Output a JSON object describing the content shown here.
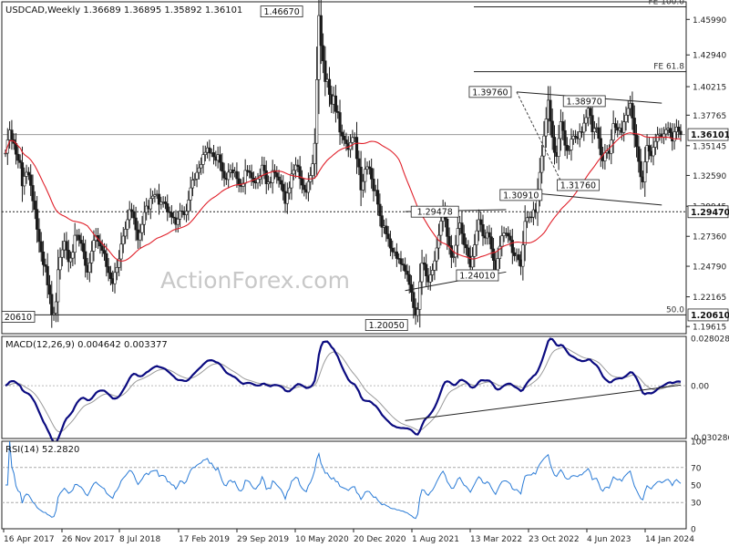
{
  "chart_data": [
    {
      "panel": "price",
      "type": "candlestick",
      "title": "USDCAD,Weekly",
      "ohlc_header": "1.36689 1.36895 1.35892 1.36101",
      "watermark": "ActionForex.com",
      "y_ticks": [
        "1.45990",
        "1.42940",
        "1.40215",
        "1.37765",
        "1.35145",
        "1.32590",
        "1.29945",
        "1.27360",
        "1.24790",
        "1.22165",
        "1.19615"
      ],
      "ylim": [
        1.19,
        1.475
      ],
      "current_price": "1.36101",
      "level_lines": [
        {
          "label": "FE 100.0",
          "value": 1.4707
        },
        {
          "label": "FE 61.8",
          "value": 1.415
        },
        {
          "label": "50.0",
          "value": 1.2061
        }
      ],
      "price_labels": [
        {
          "text": "1.46670",
          "value": 1.4667
        },
        {
          "text": "1.39760",
          "value": 1.3976
        },
        {
          "text": "1.38970",
          "value": 1.3897
        },
        {
          "text": "1.31760",
          "value": 1.3176
        },
        {
          "text": "1.30910",
          "value": 1.3091
        },
        {
          "text": "1.29478",
          "value": 1.29478
        },
        {
          "text": "1.24010",
          "value": 1.2401
        },
        {
          "text": "1.20050",
          "value": 1.2005
        },
        {
          "text": "1.20610",
          "value": 1.2061
        }
      ],
      "axis_badges": [
        {
          "text": "1.36101",
          "value": 1.36101
        },
        {
          "text": "1.29470",
          "value": 1.2947
        },
        {
          "text": "1.20610",
          "value": 1.2061
        }
      ],
      "left_edge_label": "20610",
      "x_labels": [
        "16 Apr 2017",
        "26 Nov 2017",
        "8 Jul 2018",
        "17 Feb 2019",
        "29 Sep 2019",
        "10 May 2020",
        "20 Dec 2020",
        "1 Aug 2021",
        "13 Mar 2022",
        "23 Oct 2022",
        "4 Jun 2023",
        "14 Jan 2024"
      ],
      "closes": [
        1.345,
        1.3564,
        1.3649,
        1.3566,
        1.3534,
        1.3441,
        1.3388,
        1.3369,
        1.3169,
        1.3251,
        1.3286,
        1.3264,
        1.3173,
        1.304,
        1.2967,
        1.2796,
        1.2691,
        1.2602,
        1.2492,
        1.2478,
        1.2318,
        1.2238,
        1.2065,
        1.2076,
        1.2174,
        1.2449,
        1.2556,
        1.262,
        1.2693,
        1.2617,
        1.2518,
        1.2549,
        1.2599,
        1.2745,
        1.2746,
        1.2703,
        1.2675,
        1.2605,
        1.2486,
        1.2427,
        1.2508,
        1.2609,
        1.2701,
        1.2743,
        1.2693,
        1.2653,
        1.2615,
        1.2588,
        1.2476,
        1.2424,
        1.2373,
        1.2329,
        1.2426,
        1.2469,
        1.2542,
        1.2669,
        1.2738,
        1.2797,
        1.2879,
        1.2965,
        1.2949,
        1.2894,
        1.2792,
        1.2705,
        1.2768,
        1.2838,
        1.2942,
        1.2996,
        1.2972,
        1.3061,
        1.3081,
        1.3094,
        1.3098,
        1.3011,
        1.3032,
        1.3032,
        1.3016,
        1.2946,
        1.2941,
        1.2901,
        1.2895,
        1.2838,
        1.2884,
        1.2954,
        1.2949,
        1.2921,
        1.2952,
        1.3048,
        1.3152,
        1.3219,
        1.3228,
        1.3285,
        1.3324,
        1.3353,
        1.3438,
        1.3457,
        1.3496,
        1.3452,
        1.3455,
        1.3419,
        1.3389,
        1.3437,
        1.3371,
        1.3295,
        1.3236,
        1.3224,
        1.3287,
        1.3307,
        1.3281,
        1.3293,
        1.3231,
        1.3175,
        1.3165,
        1.3192,
        1.3302,
        1.3298,
        1.3284,
        1.3237,
        1.3201,
        1.3194,
        1.3228,
        1.3256,
        1.3347,
        1.3299,
        1.3187,
        1.3203,
        1.3196,
        1.3301,
        1.3281,
        1.3246,
        1.3216,
        1.3184,
        1.3122,
        1.3018,
        1.3107,
        1.3152,
        1.3271,
        1.3303,
        1.3348,
        1.3335,
        1.3232,
        1.3176,
        1.3137,
        1.3114,
        1.3206,
        1.3258,
        1.3359,
        1.3535,
        1.4082,
        1.4632,
        1.4374,
        1.4243,
        1.4065,
        1.4084,
        1.3954,
        1.3871,
        1.3942,
        1.3808,
        1.3799,
        1.3631,
        1.3597,
        1.3564,
        1.3532,
        1.3482,
        1.3542,
        1.3585,
        1.3587,
        1.3403,
        1.3331,
        1.3134,
        1.3207,
        1.3312,
        1.3333,
        1.3321,
        1.3228,
        1.3127,
        1.3132,
        1.3012,
        1.2913,
        1.2813,
        1.2825,
        1.2756,
        1.2715,
        1.2635,
        1.2603,
        1.2603,
        1.2546,
        1.2544,
        1.2498,
        1.2489,
        1.2437,
        1.2408,
        1.2322,
        1.2255,
        1.2123,
        1.2057,
        1.2109,
        1.2346,
        1.2508,
        1.2496,
        1.2396,
        1.2344,
        1.2405,
        1.2445,
        1.2525,
        1.2636,
        1.2745,
        1.2867,
        1.2959,
        1.2884,
        1.2735,
        1.2656,
        1.2555,
        1.2559,
        1.2659,
        1.2804,
        1.2851,
        1.2759,
        1.2664,
        1.2637,
        1.2565,
        1.2472,
        1.2563,
        1.2663,
        1.2783,
        1.2879,
        1.2837,
        1.2739,
        1.2722,
        1.2768,
        1.2732,
        1.2628,
        1.2529,
        1.2445,
        1.2545,
        1.2651,
        1.2741,
        1.2764,
        1.2763,
        1.2738,
        1.2703,
        1.2595,
        1.2569,
        1.2578,
        1.2534,
        1.2478,
        1.2662,
        1.2864,
        1.2896,
        1.2902,
        1.2901,
        1.2964,
        1.2942,
        1.3118,
        1.3285,
        1.3426,
        1.3598,
        1.3744,
        1.3905,
        1.3725,
        1.3587,
        1.3456,
        1.3422,
        1.3576,
        1.3721,
        1.3644,
        1.3518,
        1.3472,
        1.3478,
        1.3571,
        1.3597,
        1.3589,
        1.3574,
        1.3634,
        1.3631,
        1.3708,
        1.3756,
        1.3836,
        1.3774,
        1.3633,
        1.3662,
        1.3669,
        1.3577,
        1.3435,
        1.3384,
        1.3454,
        1.3469,
        1.3448,
        1.3563,
        1.3704,
        1.3671,
        1.3647,
        1.3665,
        1.3628,
        1.3719,
        1.3777,
        1.3834,
        1.3878,
        1.3752,
        1.3606,
        1.3506,
        1.3379,
        1.3247,
        1.3203,
        1.3376,
        1.3516,
        1.3467,
        1.3427,
        1.3501,
        1.3551,
        1.3607,
        1.3615,
        1.3588,
        1.3615,
        1.3652,
        1.3664,
        1.3626,
        1.3554,
        1.3634,
        1.3675,
        1.3639,
        1.361
      ],
      "moving_average": {
        "name": "MA",
        "color": "#e0202a"
      },
      "triangle_lines": [
        {
          "from": {
            "x_index": 243,
            "value": 1.3976
          },
          "to": {
            "x_index": 312,
            "value": 1.388
          }
        },
        {
          "from": {
            "x_index": 243,
            "value": 1.312
          },
          "to": {
            "x_index": 312,
            "value": 1.3005
          }
        }
      ]
    },
    {
      "panel": "macd",
      "type": "line",
      "title": "MACD(12,26,9) 0.004642 0.003377",
      "y_ticks": [
        "0.028028",
        "0.00",
        "-0.030286"
      ],
      "ylim": [
        -0.031,
        0.029
      ],
      "series": [
        {
          "name": "MACD",
          "color": "#0b0b80"
        },
        {
          "name": "Signal",
          "color": "#9a9a9a"
        }
      ]
    },
    {
      "panel": "rsi",
      "type": "line",
      "title": "RSI(14) 52.2820",
      "y_ticks": [
        "100",
        "70",
        "50",
        "30",
        "0"
      ],
      "ylim": [
        0,
        100
      ],
      "levels": [
        70,
        30
      ],
      "series": [
        {
          "name": "RSI",
          "color": "#2a7bd6"
        }
      ]
    }
  ]
}
